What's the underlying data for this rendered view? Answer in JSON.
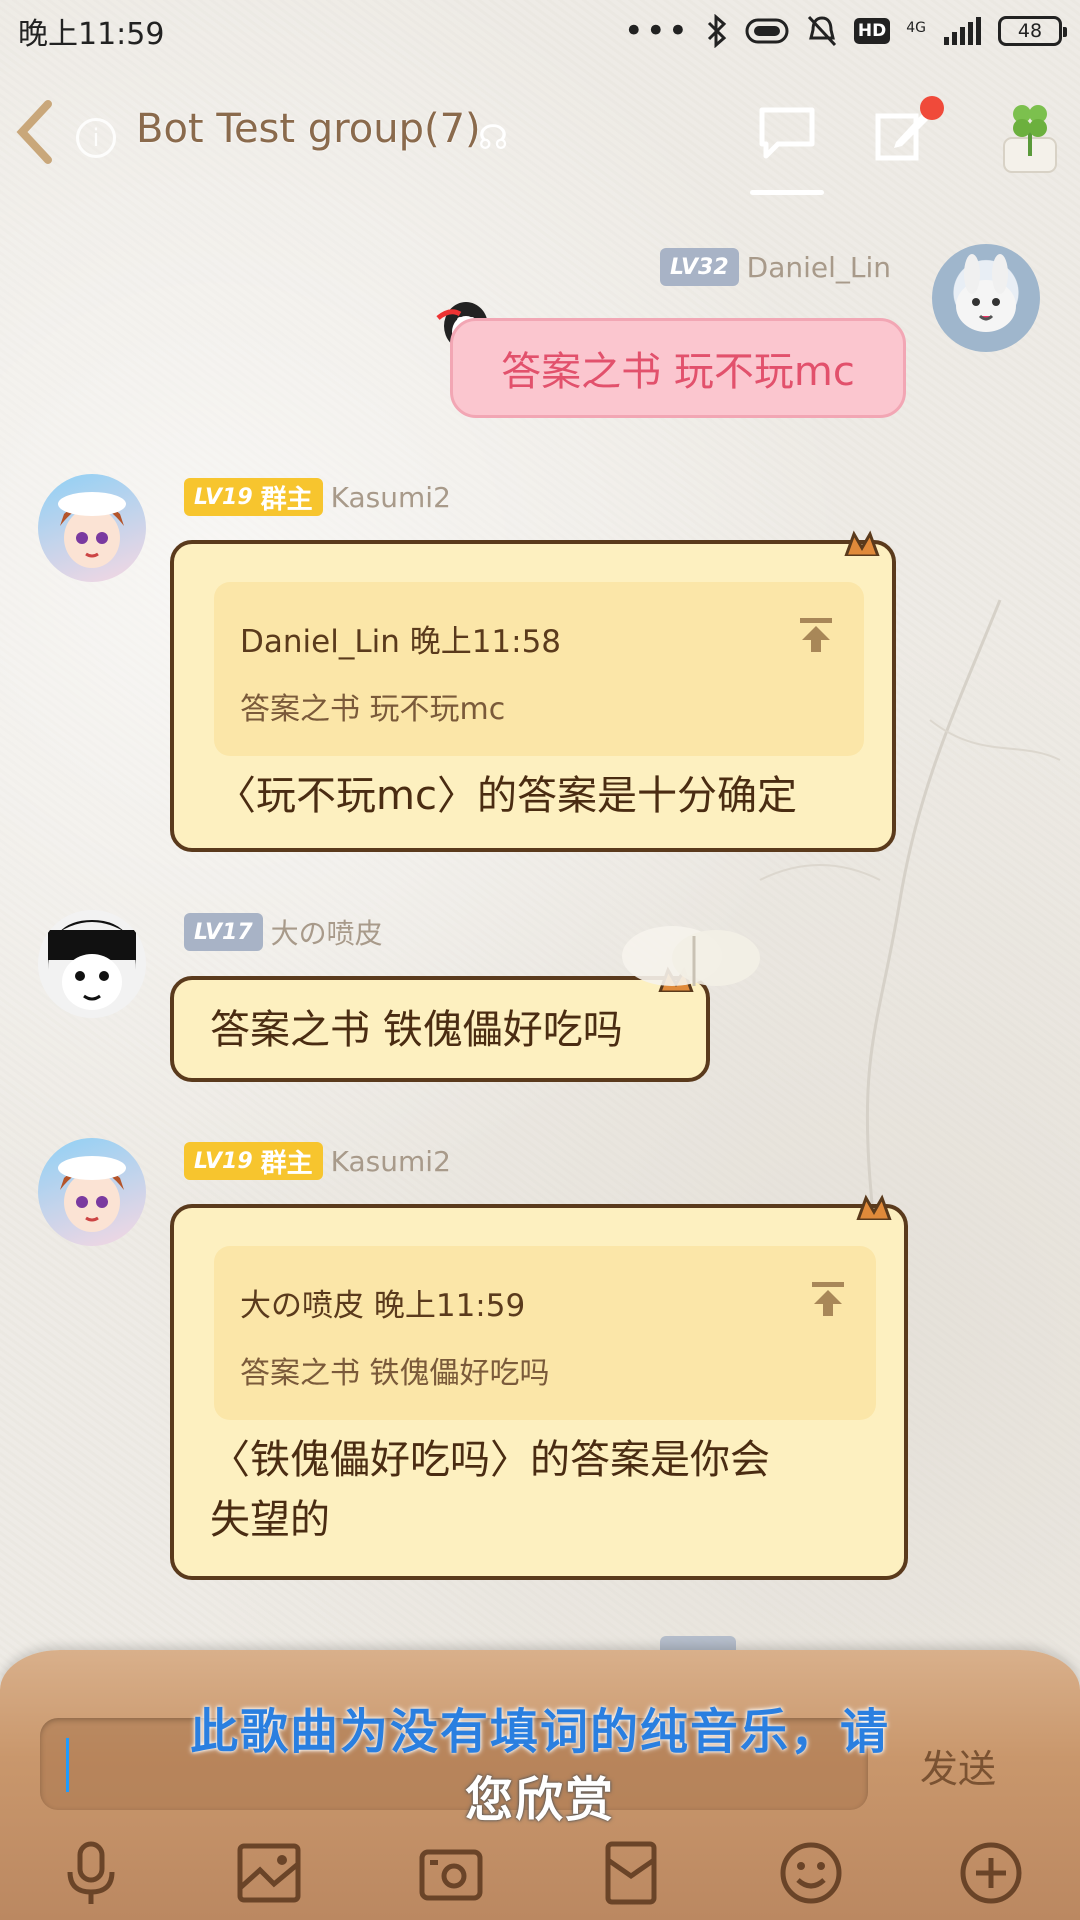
{
  "status_bar": {
    "time": "晚上11:59",
    "network": "4G",
    "battery": "48",
    "hd_badge": "HD"
  },
  "header": {
    "title": "Bot Test group(7)"
  },
  "messages": [
    {
      "sender": "Daniel_Lin",
      "level": "LV32",
      "text": "答案之书 玩不玩mc",
      "side": "right"
    },
    {
      "sender": "Kasumi2",
      "level": "LV19",
      "role": "群主",
      "quote_header": "Daniel_Lin 晚上11:58",
      "quote_text": "答案之书 玩不玩mc",
      "text": "〈玩不玩mc〉的答案是十分确定"
    },
    {
      "sender": "大の喷皮",
      "level": "LV17",
      "text": "答案之书 铁傀儡好吃吗"
    },
    {
      "sender": "Kasumi2",
      "level": "LV19",
      "role": "群主",
      "quote_header": "大の喷皮 晚上11:59",
      "quote_text": "答案之书 铁傀儡好吃吗",
      "text_line1": "〈铁傀儡好吃吗〉的答案是你会",
      "text_line2": "失望的"
    }
  ],
  "input": {
    "send_label": "发送"
  },
  "lyric": {
    "line1": "此歌曲为没有填词的纯音乐，请",
    "line2": "您欣赏"
  },
  "colors": {
    "accent_blue": "#2a7fe0",
    "bubble_cream": "#fdf0c0",
    "bubble_pink": "#fbc6cf",
    "level_gold": "#f7c52e",
    "level_gray": "#a8b3c6",
    "notification_red": "#f04a3a"
  },
  "icons": {
    "toolbar": [
      "microphone-icon",
      "image-icon",
      "camera-icon",
      "red-envelope-icon",
      "emoji-icon",
      "plus-icon"
    ]
  }
}
